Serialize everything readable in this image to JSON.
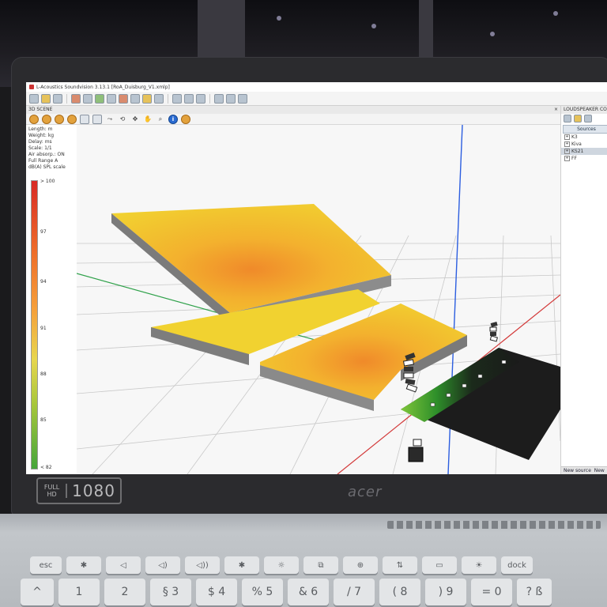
{
  "app": {
    "title": "L-Acoustics Soundvision 3.13.1 [RoA_Duisburg_V1.xmlp]"
  },
  "scene_panel": {
    "title": "3D SCENE",
    "close": "×"
  },
  "legend": {
    "info": [
      "Length: m",
      "Weight: kg",
      "Delay: ms",
      "Scale: 1/1",
      "Air absorp.: ON",
      "Full Range A",
      "dB(A) SPL scale"
    ],
    "ticks": [
      "> 100",
      "97",
      "94",
      "91",
      "88",
      "85",
      "< 82"
    ]
  },
  "loudspeaker_panel": {
    "title": "LOUDSPEAKER CONFIG",
    "tab": "Sources",
    "items": [
      {
        "label": "K3",
        "selected": false
      },
      {
        "label": "Kiva",
        "selected": false
      },
      {
        "label": "KS21",
        "selected": true
      },
      {
        "label": "FF",
        "selected": false
      }
    ],
    "bottom_buttons": [
      "New source",
      "New"
    ]
  },
  "laptop": {
    "badge_small": "FULL HD",
    "badge_big": "1080",
    "brand": "acer",
    "keys_row1": [
      "esc",
      "✱",
      "◁",
      "◁)",
      "◁))",
      "✱",
      "☼",
      "⧉",
      "⊕",
      "⇅",
      "▭",
      "☀",
      "dock"
    ],
    "keys_row2": [
      "^",
      "1",
      "2",
      "§ 3",
      "$ 4",
      "% 5",
      "& 6",
      "/ 7",
      "( 8",
      ") 9",
      "= 0",
      "? ß"
    ]
  },
  "colors": {
    "spl_high": "#d82a25",
    "spl_mid": "#f0c030",
    "spl_low": "#45a53a",
    "axis_x": "#d33a3a",
    "axis_y": "#2fa14a",
    "axis_z": "#2c5ee0"
  }
}
